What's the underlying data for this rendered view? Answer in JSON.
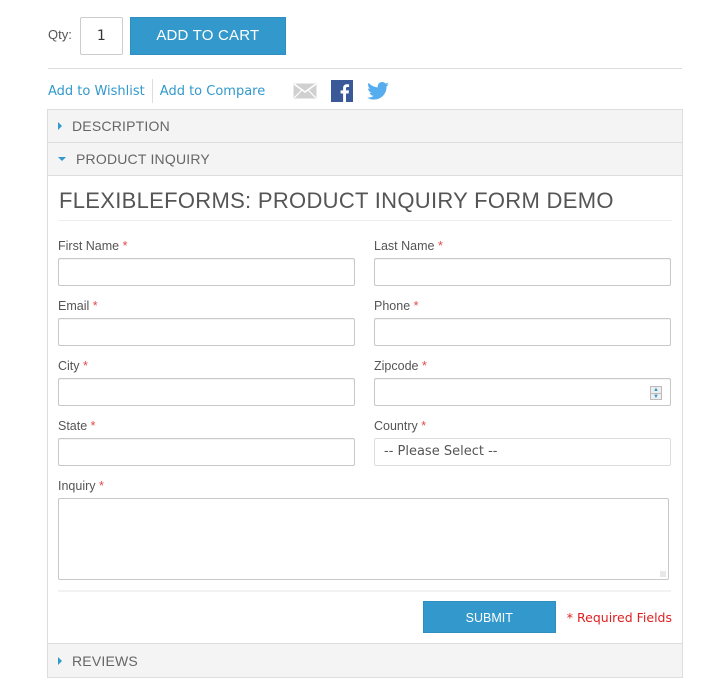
{
  "purchase": {
    "qty_label": "Qty:",
    "qty_value": "1",
    "add_to_cart_label": "ADD TO CART"
  },
  "links": {
    "wishlist": "Add to Wishlist",
    "compare": "Add to Compare",
    "share_icons": [
      "email-icon",
      "facebook-icon",
      "twitter-icon"
    ]
  },
  "colors": {
    "accent": "#3399cc",
    "required": "#e24a4a",
    "facebook": "#3b5998",
    "twitter": "#55acee"
  },
  "accordion": {
    "sections": [
      {
        "label": "DESCRIPTION",
        "expanded": false
      },
      {
        "label": "PRODUCT INQUIRY",
        "expanded": true
      },
      {
        "label": "REVIEWS",
        "expanded": false
      }
    ]
  },
  "form": {
    "title": "FLEXIBLEFORMS: PRODUCT INQUIRY FORM DEMO",
    "required_marker": "*",
    "fields": [
      {
        "label": "First Name",
        "value": ""
      },
      {
        "label": "Last Name",
        "value": ""
      },
      {
        "label": "Email",
        "value": ""
      },
      {
        "label": "Phone",
        "value": ""
      },
      {
        "label": "City",
        "value": ""
      },
      {
        "label": "Zipcode",
        "value": ""
      },
      {
        "label": "State",
        "value": ""
      },
      {
        "label": "Country",
        "selected": "-- Please Select --"
      }
    ],
    "inquiry_label": "Inquiry",
    "inquiry_value": "",
    "submit_label": "SUBMIT",
    "required_note": "* Required Fields"
  }
}
